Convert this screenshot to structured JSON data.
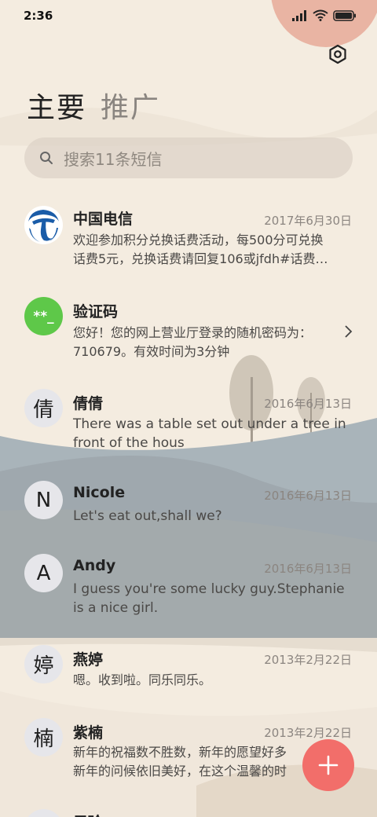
{
  "status_bar": {
    "time": "2:36"
  },
  "tabs": [
    {
      "label": "主要"
    },
    {
      "label": "推广"
    }
  ],
  "search": {
    "placeholder": "搜索11条短信"
  },
  "messages": [
    {
      "sender": "中国电信",
      "date": "2017年6月30日",
      "line1": "欢迎参加积分兑换话费活动，每500分可兑换",
      "line2": "话费5元，兑换话费请回复106或jfdh#话费…",
      "avatar_icon": "china-telecom-logo"
    },
    {
      "sender": "验证码",
      "date": "",
      "line1": "您好！您的网上营业厅登录的随机密码为：",
      "line2": "710679。有效时间为3分钟",
      "avatar_text": "**_"
    },
    {
      "sender": "倩倩",
      "date": "2016年6月13日",
      "line1": "There was a table set out under a tree in",
      "line2": "front of the hous",
      "avatar_text": "倩"
    },
    {
      "sender": "Nicole",
      "date": "2016年6月13日",
      "line1": "Let's eat out,shall we?",
      "line2": "",
      "avatar_text": "N"
    },
    {
      "sender": "Andy",
      "date": "2016年6月13日",
      "line1": "I guess you're some lucky guy.Stephanie",
      "line2": "is a nice girl.",
      "avatar_text": "A"
    },
    {
      "sender": "燕婷",
      "date": "2013年2月22日",
      "line1": "嗯。收到啦。同乐同乐。",
      "line2": "",
      "avatar_text": "婷"
    },
    {
      "sender": "紫楠",
      "date": "2013年2月22日",
      "line1": "新年的祝福数不胜数，新年的愿望好多",
      "line2": "新年的问候依旧美好，在这个温馨的时",
      "avatar_text": "楠"
    },
    {
      "sender": "子玲",
      "date": "",
      "line1": "",
      "line2": "",
      "avatar_text": ""
    }
  ],
  "colors": {
    "accent": "#f26e6a",
    "verify_avatar": "#5ec849",
    "telecom_blue": "#1a5ca8"
  }
}
